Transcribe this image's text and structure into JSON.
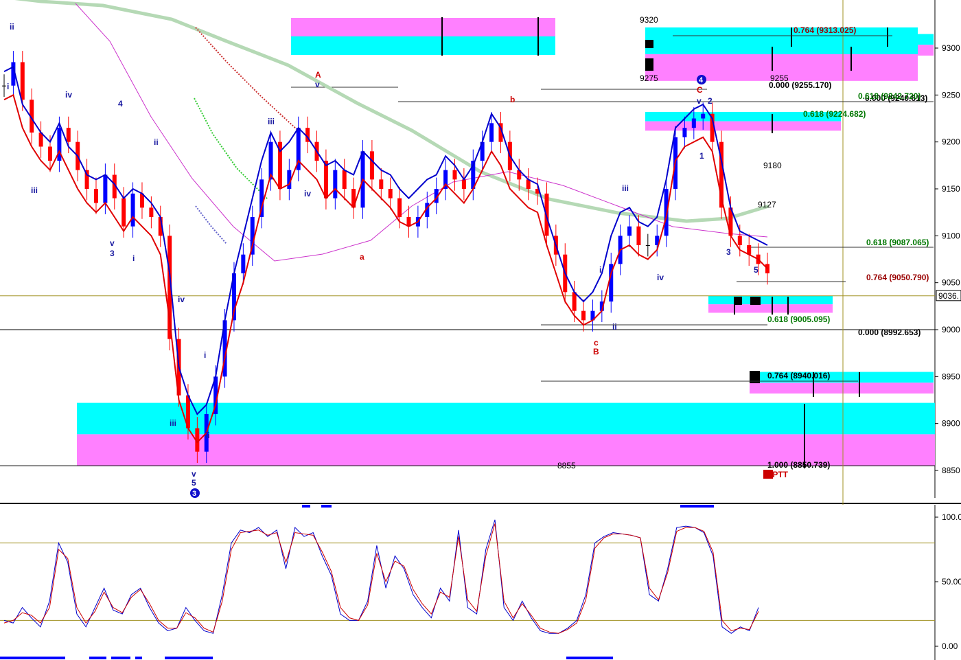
{
  "colors": {
    "background": "#ffffff",
    "bull_candle": "#0000ff",
    "bear_candle": "#ff0000",
    "neutral_candle": "#000000",
    "fast_band": "#0000cc",
    "slow_band": "#e00000",
    "long_ma": "#b5d9b5",
    "mid_ma": "#cc33cc",
    "zone_cyan": "#00ffff",
    "zone_magenta": "#ff80ff",
    "fib_green": "#007700",
    "fib_red": "#990000",
    "level_line": "#a09020",
    "axis_text": "#000000"
  },
  "chart_data": [
    {
      "type": "candlestick",
      "title": "",
      "xlabel": "",
      "ylabel": "",
      "ylim": [
        8820,
        9355
      ],
      "grid": false,
      "y_ticks": [
        "9300",
        "9250",
        "9200",
        "9150",
        "9100",
        "9050",
        "9000",
        "8950",
        "8900",
        "8850"
      ],
      "price_tag": "9036.",
      "horizontal_levels": [
        9036,
        9000,
        8855
      ],
      "series_close": [
        9260,
        9285,
        9245,
        9210,
        9195,
        9180,
        9215,
        9200,
        9170,
        9150,
        9135,
        9165,
        9140,
        9110,
        9145,
        9130,
        9120,
        9100,
        8990,
        8930,
        8895,
        8870,
        8910,
        8950,
        9010,
        9060,
        9080,
        9120,
        9160,
        9200,
        9150,
        9170,
        9215,
        9200,
        9180,
        9140,
        9170,
        9150,
        9130,
        9190,
        9160,
        9150,
        9140,
        9120,
        9110,
        9120,
        9135,
        9150,
        9170,
        9160,
        9150,
        9180,
        9200,
        9220,
        9200,
        9170,
        9160,
        9150,
        9145,
        9100,
        9080,
        9040,
        9020,
        9010,
        9020,
        9030,
        9070,
        9100,
        9110,
        9090,
        9090,
        9100,
        9150,
        9205,
        9215,
        9225,
        9230,
        9200,
        9130,
        9100,
        9090,
        9080,
        9070,
        9060
      ],
      "fast_band": [
        9275,
        9280,
        9240,
        9225,
        9210,
        9200,
        9220,
        9195,
        9185,
        9165,
        9160,
        9165,
        9155,
        9140,
        9150,
        9145,
        9135,
        9120,
        9060,
        8960,
        8930,
        8910,
        8920,
        8950,
        9010,
        9060,
        9100,
        9140,
        9180,
        9210,
        9190,
        9200,
        9215,
        9205,
        9190,
        9175,
        9180,
        9170,
        9165,
        9190,
        9180,
        9170,
        9165,
        9150,
        9140,
        9150,
        9160,
        9165,
        9185,
        9175,
        9160,
        9175,
        9200,
        9230,
        9215,
        9185,
        9170,
        9160,
        9155,
        9120,
        9090,
        9060,
        9040,
        9030,
        9040,
        9060,
        9100,
        9125,
        9130,
        9115,
        9110,
        9120,
        9160,
        9215,
        9225,
        9235,
        9240,
        9225,
        9180,
        9130,
        9105,
        9100,
        9095,
        9090
      ],
      "slow_band": [
        9245,
        9250,
        9215,
        9195,
        9180,
        9170,
        9190,
        9170,
        9150,
        9135,
        9125,
        9135,
        9120,
        9105,
        9120,
        9110,
        9100,
        9080,
        9010,
        8925,
        8895,
        8880,
        8890,
        8920,
        8970,
        9020,
        9050,
        9090,
        9130,
        9165,
        9150,
        9155,
        9180,
        9170,
        9160,
        9140,
        9150,
        9140,
        9130,
        9160,
        9150,
        9140,
        9130,
        9115,
        9110,
        9115,
        9130,
        9140,
        9155,
        9145,
        9135,
        9150,
        9170,
        9190,
        9175,
        9150,
        9140,
        9130,
        9125,
        9090,
        9060,
        9030,
        9015,
        9005,
        9010,
        9020,
        9060,
        9085,
        9090,
        9080,
        9075,
        9085,
        9120,
        9180,
        9195,
        9200,
        9205,
        9190,
        9140,
        9100,
        9085,
        9080,
        9075,
        9065
      ],
      "zones": [
        {
          "ymin": 8855,
          "ymax": 8922
        },
        {
          "ymin": 9292,
          "ymax": 9315
        },
        {
          "ymin": 9265,
          "ymax": 9322
        },
        {
          "ymin": 9212,
          "ymax": 9232
        },
        {
          "ymin": 9018,
          "ymax": 9036
        },
        {
          "ymin": 8932,
          "ymax": 8955
        }
      ],
      "fib_labels": [
        {
          "text": "0.764 (9313.025)",
          "y": 9313,
          "color": "red"
        },
        {
          "text": "0.000 (9255.170)",
          "y": 9255,
          "color": "black"
        },
        {
          "text": "0.000 (9240.613)",
          "y": 9240,
          "color": "black"
        },
        {
          "text": "0.618 (9242.720)",
          "y": 9243,
          "color": "green"
        },
        {
          "text": "0.618 (9224.682)",
          "y": 9224,
          "color": "green"
        },
        {
          "text": "0.618 (9087.065)",
          "y": 9087,
          "color": "green"
        },
        {
          "text": "0.764 (9050.790)",
          "y": 9050,
          "color": "red"
        },
        {
          "text": "0.618 (9005.095)",
          "y": 9005,
          "color": "green"
        },
        {
          "text": "0.000 (8992.653)",
          "y": 8992,
          "color": "black"
        },
        {
          "text": "0.764 (8940.016)",
          "y": 8940,
          "color": "black"
        },
        {
          "text": "1.000 (8850.739)",
          "y": 8851,
          "color": "black"
        }
      ],
      "price_notes": [
        "9320",
        "9275",
        "9255",
        "9180",
        "9127",
        "8855"
      ],
      "wave_labels": [
        "ii",
        "i",
        "iii",
        "iv",
        "4",
        "ii",
        "v",
        "3",
        "i",
        "iv",
        "iii",
        "i",
        "ii",
        "v",
        "5",
        "3",
        "iii",
        "iv",
        "v",
        "A",
        "a",
        "b",
        "c",
        "B",
        "i",
        "ii",
        "iii",
        "iv",
        "v",
        "C",
        "2",
        "4",
        "1",
        "3",
        "5"
      ],
      "ptt_label": "15PTT"
    },
    {
      "type": "line",
      "title": "",
      "xlabel": "",
      "ylabel": "",
      "ylim": [
        0,
        100
      ],
      "y_ticks": [
        "100.0",
        "50.00",
        "0.00"
      ],
      "levels": [
        80,
        20
      ],
      "series": [
        {
          "values": [
            20,
            18,
            30,
            22,
            15,
            35,
            80,
            65,
            25,
            15,
            30,
            45,
            28,
            25,
            40,
            45,
            30,
            18,
            12,
            14,
            30,
            20,
            12,
            10,
            40,
            80,
            90,
            88,
            92,
            85,
            90,
            60,
            92,
            85,
            88,
            70,
            55,
            25,
            20,
            20,
            35,
            78,
            45,
            70,
            60,
            40,
            30,
            22,
            45,
            35,
            90,
            30,
            25,
            75,
            98,
            30,
            20,
            35,
            22,
            12,
            10,
            10,
            14,
            20,
            40,
            80,
            85,
            88,
            87,
            86,
            84,
            40,
            35,
            60,
            92,
            93,
            92,
            88,
            70,
            15,
            10,
            15,
            12,
            30
          ]
        },
        {
          "values": [
            18,
            20,
            26,
            24,
            18,
            30,
            75,
            68,
            30,
            18,
            27,
            42,
            30,
            26,
            38,
            44,
            33,
            20,
            14,
            14,
            26,
            22,
            14,
            11,
            35,
            75,
            88,
            89,
            90,
            86,
            88,
            65,
            88,
            87,
            86,
            73,
            58,
            30,
            22,
            20,
            32,
            72,
            50,
            66,
            62,
            44,
            33,
            25,
            42,
            38,
            85,
            36,
            27,
            70,
            95,
            35,
            22,
            33,
            24,
            14,
            11,
            10,
            13,
            18,
            36,
            76,
            84,
            87,
            87,
            86,
            84,
            45,
            36,
            57,
            89,
            92,
            92,
            89,
            73,
            20,
            12,
            14,
            13,
            27
          ]
        }
      ]
    }
  ]
}
